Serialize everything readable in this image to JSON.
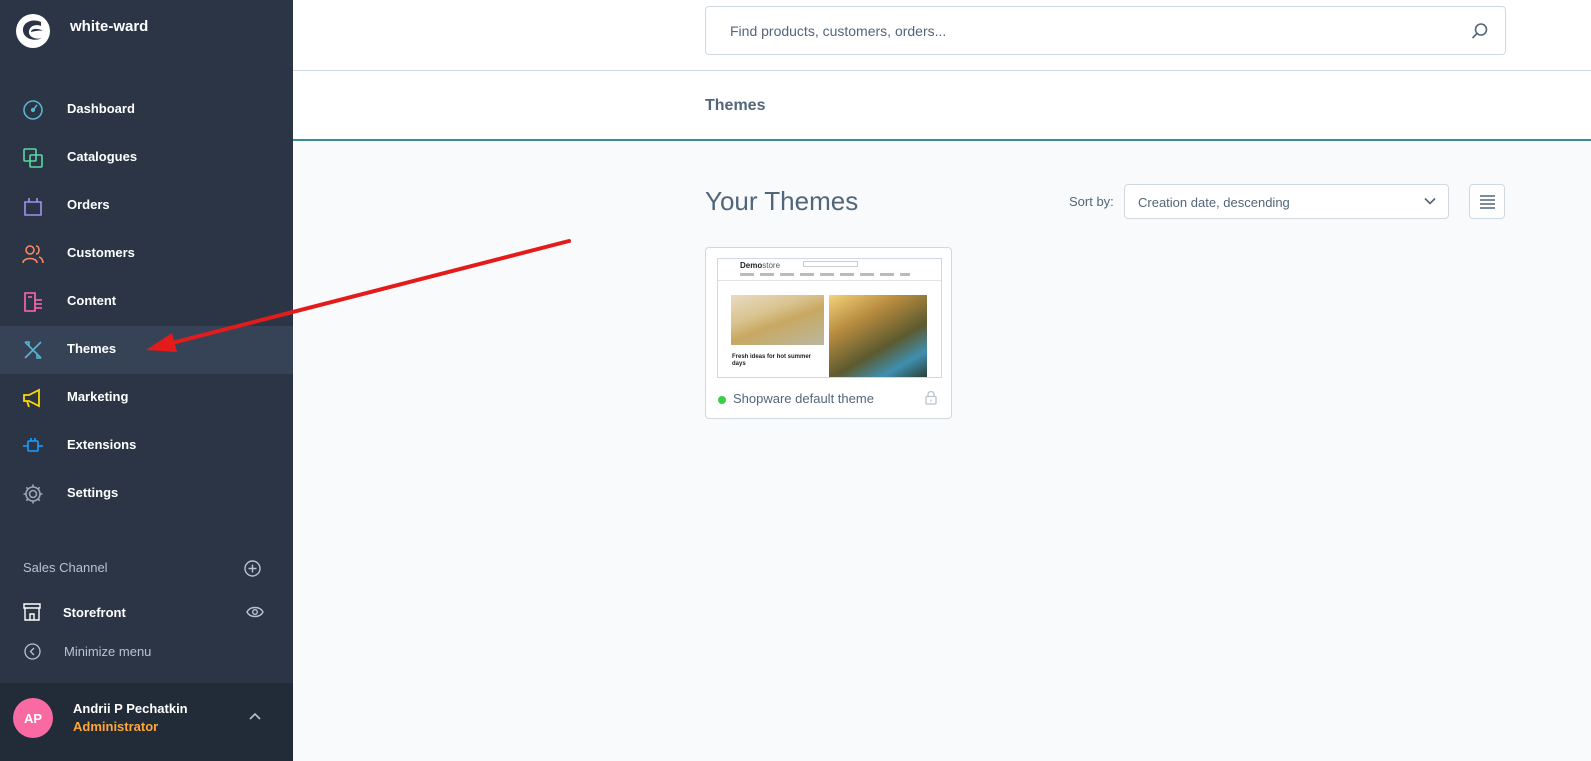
{
  "sidebar": {
    "shop_name": "white-ward",
    "items": [
      {
        "label": "Dashboard",
        "icon": "dashboard-icon",
        "color": "#57d9a3"
      },
      {
        "label": "Catalogues",
        "icon": "catalogue-icon",
        "color": "#57d9a3"
      },
      {
        "label": "Orders",
        "icon": "orders-icon",
        "color": "#a092f0"
      },
      {
        "label": "Customers",
        "icon": "customers-icon",
        "color": "#f88962"
      },
      {
        "label": "Content",
        "icon": "content-icon",
        "color": "#ff68b4"
      },
      {
        "label": "Themes",
        "icon": "themes-icon",
        "color": "#58b4d0"
      },
      {
        "label": "Marketing",
        "icon": "marketing-icon",
        "color": "#ffd700"
      },
      {
        "label": "Extensions",
        "icon": "extensions-icon",
        "color": "#189eff"
      },
      {
        "label": "Settings",
        "icon": "settings-icon",
        "color": "#9aa8b5"
      }
    ],
    "active_item": "Themes",
    "sales_channel_header": "Sales Channel",
    "sales_channel_item": "Storefront",
    "minimize_label": "Minimize menu",
    "user": {
      "initials": "AP",
      "name": "Andrii P Pechatkin",
      "role": "Administrator"
    }
  },
  "search": {
    "placeholder": "Find products, customers, orders..."
  },
  "page": {
    "title": "Themes"
  },
  "themes": {
    "section_title": "Your Themes",
    "sort_label": "Sort by:",
    "sort_value": "Creation date, descending",
    "cards": [
      {
        "name": "Shopware default theme",
        "active": true,
        "locked": true,
        "preview_logo_bold": "Demo",
        "preview_logo_light": "store",
        "preview_headline": "Fresh ideas for hot summer days"
      }
    ]
  },
  "colors": {
    "sidebar_bg": "#2b3545",
    "accent_line": "#3a8f97",
    "annotation_arrow": "#e31b1b",
    "active_dot": "#37d046",
    "avatar": "#f96aa3",
    "role": "#ffa638"
  }
}
